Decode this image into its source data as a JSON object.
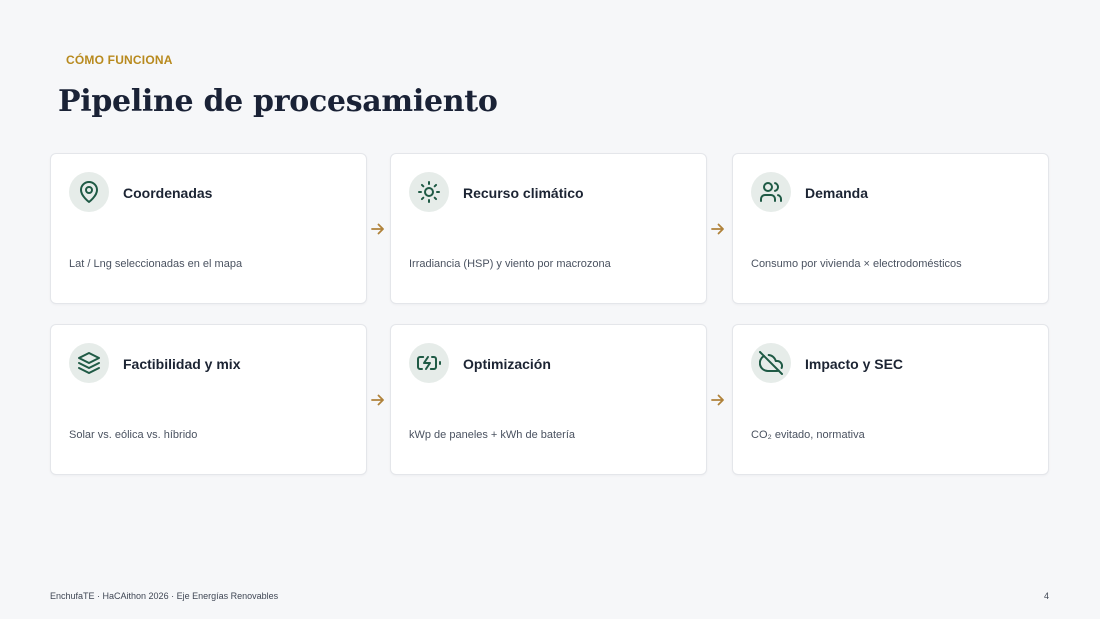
{
  "header": {
    "eyebrow": "CÓMO FUNCIONA",
    "title": "Pipeline de procesamiento"
  },
  "steps": [
    {
      "title": "Coordenadas",
      "desc": "Lat / Lng seleccionadas en el mapa",
      "icon": "map-pin-icon"
    },
    {
      "title": "Recurso climático",
      "desc": "Irradiancia (HSP) y viento por macrozona",
      "icon": "sun-icon"
    },
    {
      "title": "Demanda",
      "desc": "Consumo por vivienda × electrodomésticos",
      "icon": "users-icon"
    },
    {
      "title": "Factibilidad y mix",
      "desc": "Solar vs. eólica vs. híbrido",
      "icon": "layers-icon"
    },
    {
      "title": "Optimización",
      "desc": "kWp de paneles + kWh de batería",
      "icon": "battery-charging-icon"
    },
    {
      "title": "Impacto y SEC",
      "desc": "CO₂ evitado, normativa",
      "icon": "cloud-off-icon"
    }
  ],
  "footer": {
    "left": "EnchufaTE · HaCAithon 2026 · Eje Energías Renovables",
    "page_number": "4"
  },
  "colors": {
    "accent": "#b88a1e",
    "icon_green": "#1f5a45",
    "icon_bg": "#e6ece9",
    "arrow": "#b0823a"
  }
}
